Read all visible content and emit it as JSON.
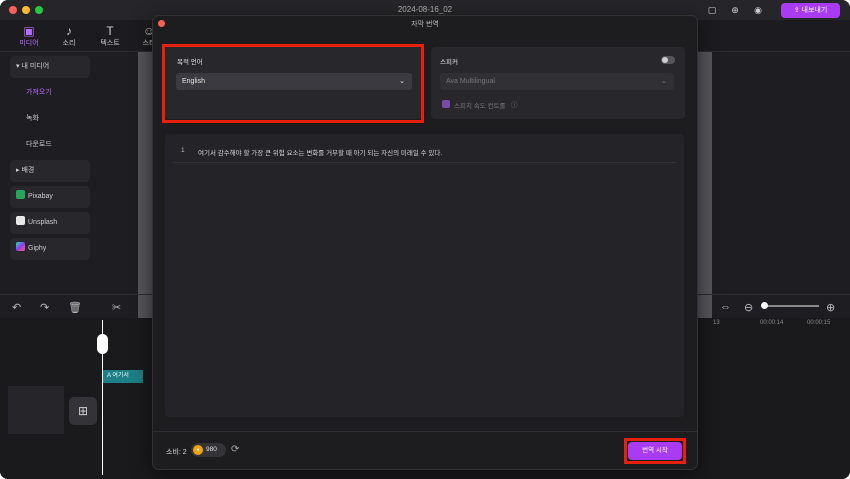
{
  "window": {
    "title": "2024-08-16_02",
    "export_label": "내보내기"
  },
  "toolbar": {
    "tabs": [
      {
        "label": "미디어",
        "icon": "media-icon"
      },
      {
        "label": "소리",
        "icon": "music-note-icon"
      },
      {
        "label": "텍스트",
        "icon": "text-icon"
      },
      {
        "label": "스티",
        "icon": "sticker-icon"
      }
    ]
  },
  "sidebar": {
    "my_media": "내 미디어",
    "items": [
      "가져오기",
      "녹화",
      "다운로드"
    ],
    "background": "배경",
    "sources": [
      "Pixabay",
      "Unsplash",
      "Giphy"
    ]
  },
  "timeline": {
    "ticks": [
      "13",
      "00:00:14",
      "00:00:15"
    ],
    "clip_label": "여기서"
  },
  "dialog": {
    "title": "자막 번역",
    "target_language_label": "목적 언어",
    "target_language_value": "English",
    "speaker_label": "스피커",
    "speaker_value": "Ava Multilingual",
    "speaker_checkbox_label": "스피치 속도 컨트롤",
    "lines": [
      {
        "num": "1",
        "text": "여기서 감수해야 할 가장 큰 위험 요소는 변화를 거부할 때 아기 되는 자신의 미래일 수 있다."
      }
    ],
    "consume_label": "소비: 2",
    "coin_value": "980",
    "start_label": "번역 시작"
  },
  "colors": {
    "accent": "#a93cf2",
    "highlight": "#e8200e"
  }
}
